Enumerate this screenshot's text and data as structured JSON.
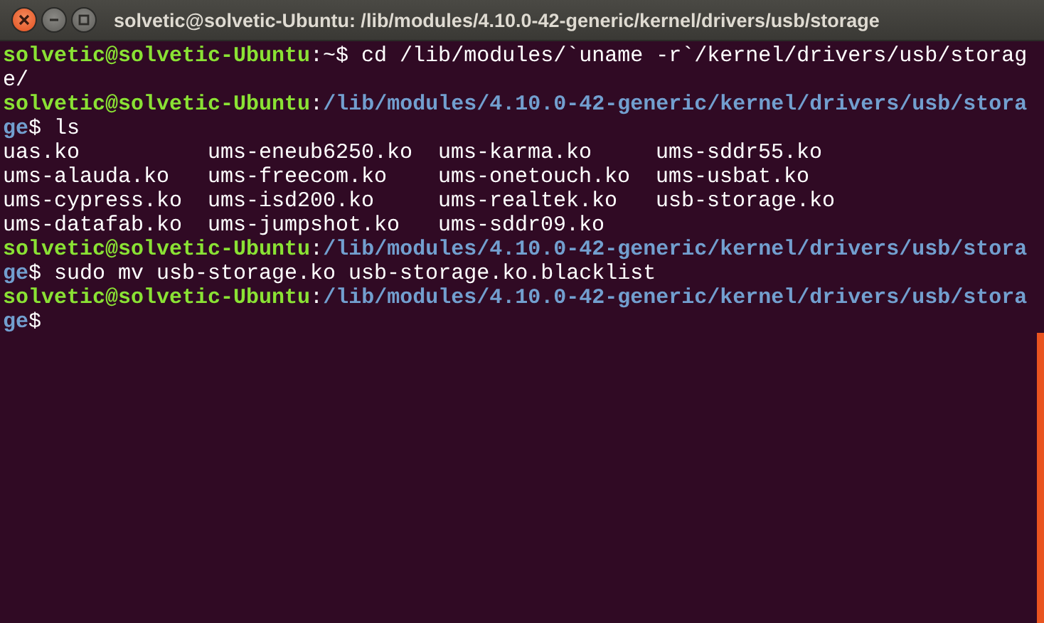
{
  "window": {
    "title": "solvetic@solvetic-Ubuntu: /lib/modules/4.10.0-42-generic/kernel/drivers/usb/storage"
  },
  "terminal": {
    "lines": [
      {
        "kind": "text",
        "segments": [
          {
            "kind": "user",
            "text": "solvetic@solvetic-Ubuntu"
          },
          {
            "kind": "plain",
            "text": ":~$ cd /lib/modules/`uname -r`/kernel/drivers/usb/storag"
          }
        ]
      },
      {
        "kind": "text",
        "segments": [
          {
            "kind": "plain",
            "text": "e/"
          }
        ]
      },
      {
        "kind": "text",
        "segments": [
          {
            "kind": "user",
            "text": "solvetic@solvetic-Ubuntu"
          },
          {
            "kind": "plain",
            "text": ":"
          },
          {
            "kind": "path",
            "text": "/lib/modules/4.10.0-42-generic/kernel/drivers/usb/stora"
          }
        ]
      },
      {
        "kind": "text",
        "segments": [
          {
            "kind": "path",
            "text": "ge"
          },
          {
            "kind": "plain",
            "text": "$ ls"
          }
        ]
      },
      {
        "kind": "listing",
        "rows": [
          [
            "uas.ko",
            "ums-eneub6250.ko",
            "ums-karma.ko",
            "ums-sddr55.ko"
          ],
          [
            "ums-alauda.ko",
            "ums-freecom.ko",
            "ums-onetouch.ko",
            "ums-usbat.ko"
          ],
          [
            "ums-cypress.ko",
            "ums-isd200.ko",
            "ums-realtek.ko",
            "usb-storage.ko"
          ],
          [
            "ums-datafab.ko",
            "ums-jumpshot.ko",
            "ums-sddr09.ko"
          ]
        ]
      },
      {
        "kind": "text",
        "segments": [
          {
            "kind": "user",
            "text": "solvetic@solvetic-Ubuntu"
          },
          {
            "kind": "plain",
            "text": ":"
          },
          {
            "kind": "path",
            "text": "/lib/modules/4.10.0-42-generic/kernel/drivers/usb/stora"
          }
        ]
      },
      {
        "kind": "text",
        "segments": [
          {
            "kind": "path",
            "text": "ge"
          },
          {
            "kind": "plain",
            "text": "$ sudo mv usb-storage.ko usb-storage.ko.blacklist"
          }
        ]
      },
      {
        "kind": "text",
        "segments": [
          {
            "kind": "user",
            "text": "solvetic@solvetic-Ubuntu"
          },
          {
            "kind": "plain",
            "text": ":"
          },
          {
            "kind": "path",
            "text": "/lib/modules/4.10.0-42-generic/kernel/drivers/usb/stora"
          }
        ]
      },
      {
        "kind": "text",
        "segments": [
          {
            "kind": "path",
            "text": "ge"
          },
          {
            "kind": "plain",
            "text": "$"
          }
        ]
      }
    ]
  }
}
